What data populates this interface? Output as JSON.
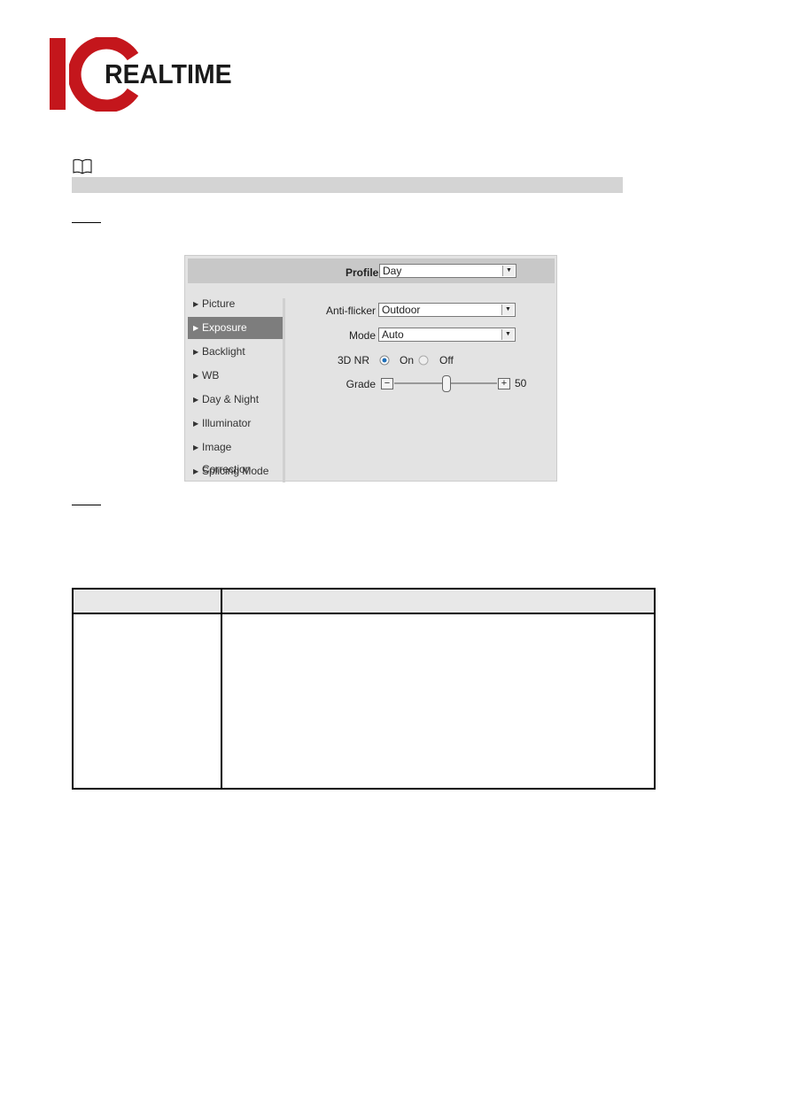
{
  "logo": {
    "brand_text": "REALTIME",
    "brand_color": "#c4161c"
  },
  "note": {
    "icon": "book-icon"
  },
  "screenshot": {
    "profile": {
      "label": "Profile",
      "value": "Day"
    },
    "sidebar": {
      "items": [
        {
          "label": "Picture"
        },
        {
          "label": "Exposure",
          "active": true
        },
        {
          "label": "Backlight"
        },
        {
          "label": "WB"
        },
        {
          "label": "Day & Night"
        },
        {
          "label": "Illuminator"
        },
        {
          "label": "Image Correction"
        },
        {
          "label": "Splicing Mode"
        }
      ]
    },
    "anti_flicker": {
      "label": "Anti-flicker",
      "value": "Outdoor"
    },
    "mode": {
      "label": "Mode",
      "value": "Auto"
    },
    "nr3d": {
      "label": "3D NR",
      "on_label": "On",
      "off_label": "Off",
      "selected": "On"
    },
    "grade": {
      "label": "Grade",
      "value": "50",
      "minus": "−",
      "plus": "+"
    }
  }
}
